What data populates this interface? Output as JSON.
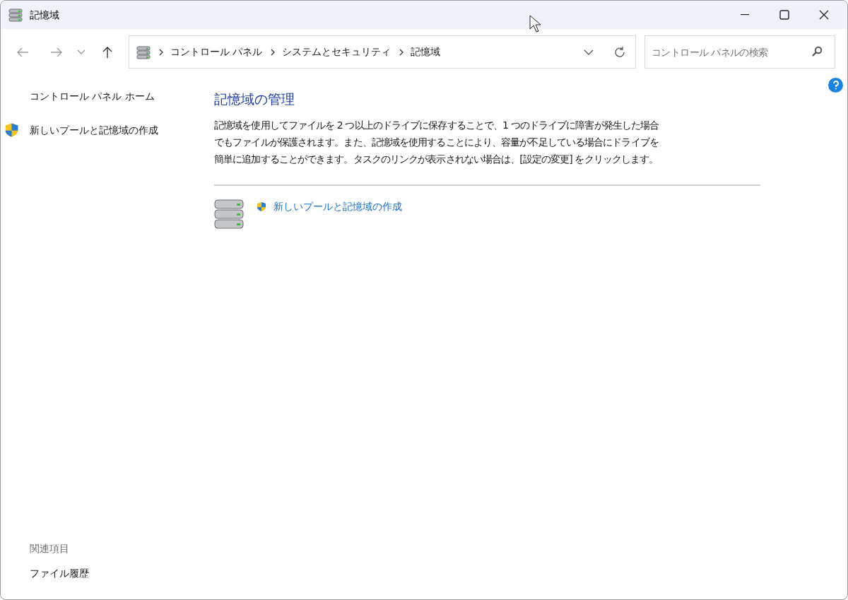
{
  "window": {
    "title": "記憶域"
  },
  "breadcrumb": [
    "コントロール パネル",
    "システムとセキュリティ",
    "記憶域"
  ],
  "search": {
    "placeholder": "コントロール パネルの検索"
  },
  "sidebar": {
    "items": [
      {
        "label": "コントロール パネル ホーム",
        "kind": "link"
      },
      {
        "label": "新しいプールと記憶域の作成",
        "kind": "shield"
      }
    ],
    "related_heading": "関連項目",
    "related": [
      "ファイル履歴"
    ]
  },
  "main": {
    "heading": "記憶域の管理",
    "description": "記憶域を使用してファイルを 2 つ以上のドライブに保存することで、1 つのドライブに障害が発生した場合でもファイルが保護されます。また、記憶域を使用することにより、容量が不足している場合にドライブを簡単に追加することができます。タスクのリンクが表示されない場合は、[設定の変更] をクリックします。",
    "task": "新しいプールと記憶域の作成"
  }
}
